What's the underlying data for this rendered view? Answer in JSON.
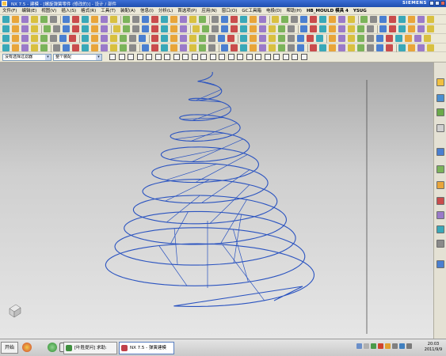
{
  "titlebar": {
    "title": "NX 7.5 - 建模 - [螺旋弹簧零件 (修改的)] - 设计 / 部件",
    "brand": "SIEMENS",
    "buttons": [
      "minimize",
      "maximize",
      "close"
    ]
  },
  "menubar": {
    "items": [
      "文件(F)",
      "编辑(E)",
      "视图(V)",
      "插入(S)",
      "格式(R)",
      "工具(T)",
      "装配(A)",
      "信息(I)",
      "分析(L)",
      "首选项(P)",
      "应用(N)",
      "窗口(O)",
      "GC工具箱",
      "电极(D)",
      "帮助(H)",
      "HB_MOULD 模具 4",
      "YSUG"
    ]
  },
  "filterbar": {
    "type_filter": "没有选择过滤器",
    "scope_filter": "整个装配"
  },
  "taskbar": {
    "start_label": "开始",
    "tasks": [
      {
        "label": "[叶胜提问] 求助:",
        "icon_color": "#3f8f3f"
      },
      {
        "label": "NX 7.5 - 弹簧建模",
        "icon_color": "#c0404a"
      }
    ],
    "clock_time": "20:03",
    "clock_date": "2011/9/9"
  },
  "colors": {
    "curve": "#2a53c0",
    "accent": "#2a53c0",
    "titlebar": "#2a5bc4",
    "chrome": "#ece9d8"
  },
  "icons": {
    "start": "start-orb-icon",
    "quicklaunch": [
      "media-icon",
      "ie-icon",
      "desktop-icon"
    ],
    "resource_bar": [
      "assembly-navigator-icon",
      "part-navigator-icon",
      "reuse-library-icon",
      "web-browser-icon",
      "history-icon",
      "system-materials-icon",
      "process-studio-icon",
      "roles-icon",
      "palette-icon",
      "view-icon",
      "layer-icon",
      "help-icon"
    ]
  }
}
